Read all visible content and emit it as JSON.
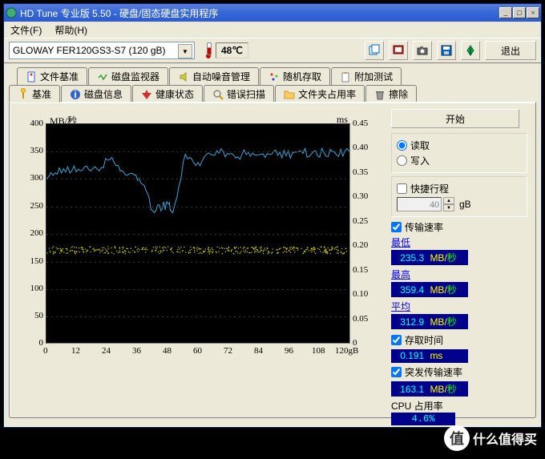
{
  "title": "HD Tune 专业版 5.50 - 硬盘/固态硬盘实用程序",
  "menu": {
    "file": "文件(F)",
    "help": "帮助(H)"
  },
  "drive": "GLOWAY FER120GS3-S7 (120 gB)",
  "temperature": "48℃",
  "exit_label": "退出",
  "tabs_row1": [
    {
      "label": "文件基准"
    },
    {
      "label": "磁盘监视器"
    },
    {
      "label": "自动噪音管理"
    },
    {
      "label": "随机存取"
    },
    {
      "label": "附加测试"
    }
  ],
  "tabs_row2": [
    {
      "label": "基准",
      "active": true
    },
    {
      "label": "磁盘信息"
    },
    {
      "label": "健康状态"
    },
    {
      "label": "错误扫描"
    },
    {
      "label": "文件夹占用率"
    },
    {
      "label": "擦除"
    }
  ],
  "chart": {
    "y_unit": "MB/秒",
    "y2_unit": "ms",
    "y_ticks": [
      "400",
      "350",
      "300",
      "250",
      "200",
      "150",
      "100",
      "50",
      "0"
    ],
    "y2_ticks": [
      "0.45",
      "0.40",
      "0.35",
      "0.30",
      "0.25",
      "0.20",
      "0.15",
      "0.10",
      "0.05",
      "0"
    ],
    "x_ticks": [
      "0",
      "12",
      "24",
      "36",
      "48",
      "60",
      "72",
      "84",
      "96",
      "108",
      "120gB"
    ]
  },
  "chart_data": {
    "type": "line",
    "title": "",
    "xlabel": "gB",
    "ylabel": "MB/秒",
    "y2label": "ms",
    "xlim": [
      0,
      120
    ],
    "ylim": [
      0,
      400
    ],
    "y2lim": [
      0,
      0.45
    ],
    "series": [
      {
        "name": "传输速率",
        "axis": "y",
        "color": "#41a6d9",
        "x": [
          0,
          5,
          10,
          15,
          20,
          25,
          30,
          34,
          38,
          42,
          46,
          48,
          50,
          55,
          60,
          65,
          70,
          75,
          80,
          85,
          90,
          95,
          100,
          105,
          110,
          115,
          120
        ],
        "values": [
          300,
          320,
          315,
          322,
          318,
          335,
          315,
          310,
          290,
          242,
          248,
          255,
          238,
          345,
          330,
          345,
          350,
          338,
          348,
          345,
          350,
          342,
          350,
          345,
          348,
          344,
          350
        ]
      },
      {
        "name": "存取时间",
        "axis": "y2",
        "color": "#d4d000",
        "style": "scatter",
        "x": [
          0,
          10,
          20,
          30,
          40,
          50,
          60,
          70,
          80,
          90,
          100,
          110,
          120
        ],
        "values": [
          0.19,
          0.19,
          0.19,
          0.19,
          0.19,
          0.19,
          0.2,
          0.19,
          0.19,
          0.19,
          0.19,
          0.19,
          0.19
        ]
      }
    ]
  },
  "panel": {
    "start": "开始",
    "read": "读取",
    "write": "写入",
    "shortstroke": "快捷行程",
    "stroke_value": "40",
    "stroke_unit": "gB",
    "transfer_rate": "传输速率",
    "min_label": "最低",
    "min_value": "235.3",
    "min_unit1": "MB/",
    "min_unit2": "秒",
    "max_label": "最高",
    "max_value": "359.4",
    "avg_label": "平均",
    "avg_value": "312.9",
    "access_label": "存取时间",
    "access_value": "0.191",
    "access_unit": "ms",
    "burst_label": "突发传输速率",
    "burst_value": "163.1",
    "cpu_label": "CPU 占用率",
    "cpu_value": "4.6%"
  },
  "watermark": {
    "icon": "值",
    "text": "什么值得买"
  }
}
